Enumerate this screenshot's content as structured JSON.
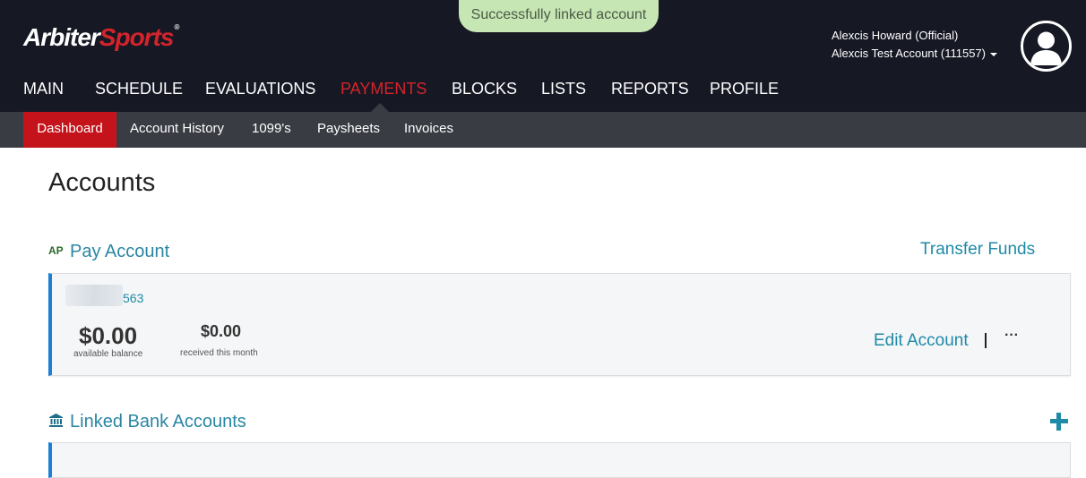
{
  "brand": {
    "part1": "Arbiter",
    "part2": "Sports",
    "mark": "®"
  },
  "toast": {
    "message": "Successfully linked account"
  },
  "user": {
    "name": "Alexcis Howard (Official)",
    "account": "Alexcis Test Account (111557)"
  },
  "main_nav": {
    "items": [
      {
        "label": "MAIN"
      },
      {
        "label": "SCHEDULE"
      },
      {
        "label": "EVALUATIONS"
      },
      {
        "label": "PAYMENTS",
        "active": true
      },
      {
        "label": "BLOCKS"
      },
      {
        "label": "LISTS"
      },
      {
        "label": "REPORTS"
      },
      {
        "label": "PROFILE"
      }
    ]
  },
  "sub_nav": {
    "items": [
      {
        "label": "Dashboard",
        "active": true
      },
      {
        "label": "Account History"
      },
      {
        "label": "1099's"
      },
      {
        "label": "Paysheets"
      },
      {
        "label": "Invoices"
      }
    ]
  },
  "page": {
    "title": "Accounts"
  },
  "pay_account": {
    "badge": "AP",
    "title": "Pay Account",
    "transfer_label": "Transfer Funds",
    "account_suffix": "563",
    "available_balance": "$0.00",
    "available_balance_label": "available balance",
    "received_this_month": "$0.00",
    "received_label": "received this month",
    "edit_label": "Edit Account",
    "more_label": "···"
  },
  "linked_bank": {
    "title": "Linked Bank Accounts"
  },
  "colors": {
    "nav_bg": "#161824",
    "subnav_bg": "#3a3c44",
    "accent_red": "#d4242b",
    "link_teal": "#1f8aa7",
    "toast_green": "#c6e6b4"
  },
  "icons": [
    "user-avatar-icon",
    "caret-down-icon",
    "bank-icon",
    "plus-icon",
    "more-icon"
  ]
}
